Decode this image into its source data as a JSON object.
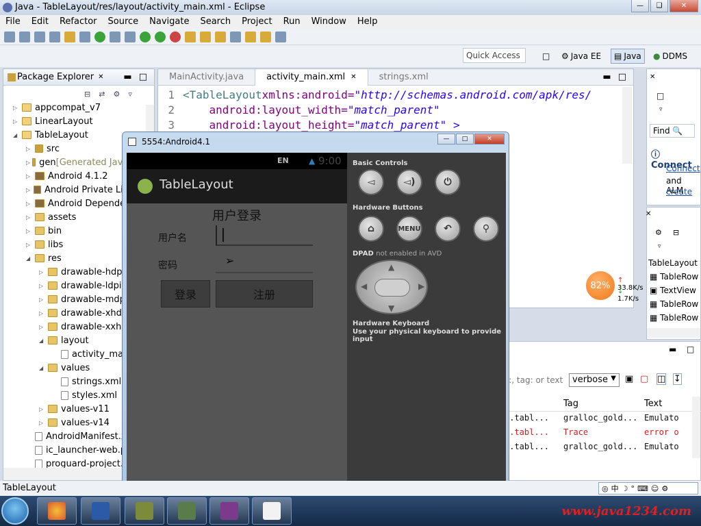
{
  "window": {
    "title": "Java - TableLayout/res/layout/activity_main.xml - Eclipse"
  },
  "menu": [
    "File",
    "Edit",
    "Refactor",
    "Source",
    "Navigate",
    "Search",
    "Project",
    "Run",
    "Window",
    "Help"
  ],
  "quick_access": {
    "placeholder": "Quick Access"
  },
  "perspectives": {
    "java_ee": "Java EE",
    "java": "Java",
    "ddms": "DDMS"
  },
  "package_explorer": {
    "tab": "Package Explorer",
    "items": [
      {
        "label": "appcompat_v7",
        "indent": 0,
        "icon": "project"
      },
      {
        "label": "LinearLayout",
        "indent": 0,
        "icon": "project"
      },
      {
        "label": "TableLayout",
        "indent": 0,
        "icon": "project"
      },
      {
        "label": "src",
        "indent": 1,
        "icon": "package"
      },
      {
        "label": "gen",
        "extra": "[Generated Java Files]",
        "indent": 1,
        "icon": "package"
      },
      {
        "label": "Android 4.1.2",
        "indent": 1,
        "icon": "jar"
      },
      {
        "label": "Android Private Libraries",
        "indent": 1,
        "icon": "jar"
      },
      {
        "label": "Android Dependencies",
        "indent": 1,
        "icon": "jar"
      },
      {
        "label": "assets",
        "indent": 1,
        "icon": "folder"
      },
      {
        "label": "bin",
        "indent": 1,
        "icon": "folder"
      },
      {
        "label": "libs",
        "indent": 1,
        "icon": "folder"
      },
      {
        "label": "res",
        "indent": 1,
        "icon": "folder"
      },
      {
        "label": "drawable-hdpi",
        "indent": 2,
        "icon": "folder"
      },
      {
        "label": "drawable-ldpi",
        "indent": 2,
        "icon": "folder"
      },
      {
        "label": "drawable-mdpi",
        "indent": 2,
        "icon": "folder"
      },
      {
        "label": "drawable-xhdpi",
        "indent": 2,
        "icon": "folder"
      },
      {
        "label": "drawable-xxhdpi",
        "indent": 2,
        "icon": "folder"
      },
      {
        "label": "layout",
        "indent": 2,
        "icon": "folder"
      },
      {
        "label": "activity_main.xml",
        "indent": 3,
        "icon": "file"
      },
      {
        "label": "values",
        "indent": 2,
        "icon": "folder"
      },
      {
        "label": "strings.xml",
        "indent": 3,
        "icon": "file"
      },
      {
        "label": "styles.xml",
        "indent": 3,
        "icon": "file"
      },
      {
        "label": "values-v11",
        "indent": 2,
        "icon": "folder"
      },
      {
        "label": "values-v14",
        "indent": 2,
        "icon": "folder"
      },
      {
        "label": "AndroidManifest.xml",
        "indent": 1,
        "icon": "file"
      },
      {
        "label": "ic_launcher-web.png",
        "indent": 1,
        "icon": "file"
      },
      {
        "label": "proguard-project.txt",
        "indent": 1,
        "icon": "file"
      }
    ]
  },
  "editor": {
    "tabs": [
      "MainActivity.java",
      "activity_main.xml",
      "strings.xml"
    ],
    "active_tab": 1,
    "lines": [
      {
        "n": "1",
        "tag": "<TableLayout",
        "attr": " xmlns:android=",
        "val": "\"http://schemas.android.com/apk/res/"
      },
      {
        "n": "2",
        "tag": "",
        "attr": "    android:layout_width=",
        "val": "\"match_parent\""
      },
      {
        "n": "3",
        "tag": "",
        "attr": "    android:layout_height=",
        "val": "\"match_parent\" >"
      }
    ]
  },
  "right_top": {
    "find": "Find",
    "connect_title": "Connect",
    "connect_link": "Connect",
    "and": "and ALM",
    "create": "create"
  },
  "outline": {
    "root": "TableLayout",
    "items": [
      "TableRow",
      "TextView",
      "TableRow",
      "TableRow"
    ]
  },
  "net_widget": {
    "percent": "82%",
    "up": "33.8K/s",
    "down": "1.7K/s"
  },
  "logcat": {
    "search_placeholder": "s:, tag: or text",
    "level": "verbose",
    "columns": {
      "tag": "Tag",
      "text": "Text"
    },
    "rows": [
      {
        "app": "4.tabl...",
        "tag": "gralloc_gold...",
        "text": "Emulato",
        "level": "normal"
      },
      {
        "app": "4.tabl...",
        "tag": "Trace",
        "text": "error o",
        "level": "error"
      },
      {
        "app": "4.tabl...",
        "tag": "gralloc_gold...",
        "text": "Emulato",
        "level": "normal"
      }
    ]
  },
  "emulator": {
    "title": "5554:Android4.1",
    "status_bar": {
      "lang": "EN",
      "time": "9:00"
    },
    "app_name": "TableLayout",
    "login_title": "用户登录",
    "username_label": "用户名",
    "password_label": "密码",
    "login_btn": "登录",
    "register_btn": "注册",
    "controls": {
      "basic": "Basic Controls",
      "hardware": "Hardware Buttons",
      "menu": "MENU",
      "dpad": "DPAD",
      "dpad_note": "not enabled in AVD",
      "keyboard": "Hardware Keyboard",
      "keyboard_note": "Use your physical keyboard to provide input"
    }
  },
  "status_line": "TableLayout",
  "watermark": "www.java1234.com"
}
